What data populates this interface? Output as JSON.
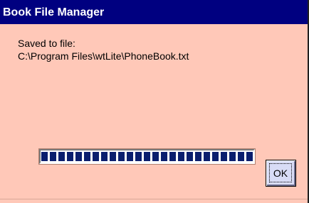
{
  "window": {
    "title": "Book File Manager"
  },
  "message": {
    "line1": "Saved to file:",
    "line2": "C:\\Program Files\\wtLite\\PhoneBook.txt"
  },
  "progress": {
    "fraction": 1.0
  },
  "buttons": {
    "ok_label": "OK"
  },
  "colors": {
    "titlebar": "#000080",
    "dialog_background": "#ffc8b8",
    "progress_fill": "#0a1e6e",
    "button_face": "#d8dcf6"
  }
}
